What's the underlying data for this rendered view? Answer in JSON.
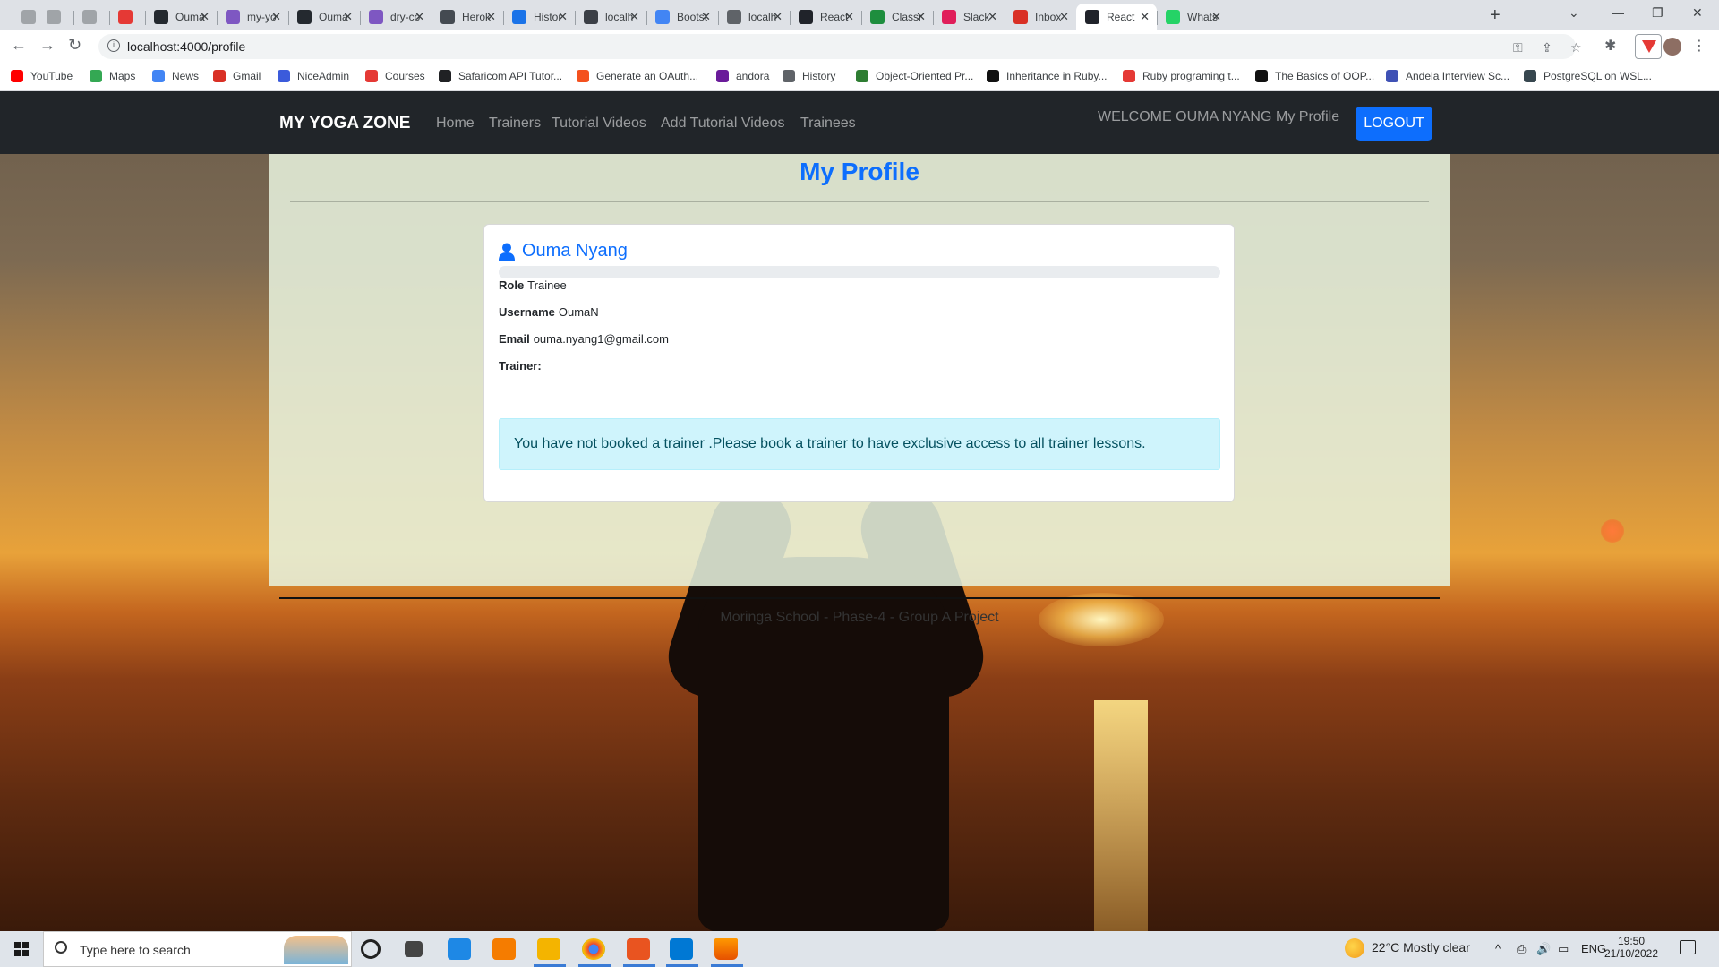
{
  "browser": {
    "tabs": [
      {
        "label": "",
        "color": "#a0a4a8"
      },
      {
        "label": "",
        "color": "#a0a4a8"
      },
      {
        "label": "",
        "color": "#a0a4a8"
      },
      {
        "label": "",
        "color": "#e53935"
      },
      {
        "label": "Ouma",
        "color": "#24292f"
      },
      {
        "label": "my-yo",
        "color": "#7e57c2"
      },
      {
        "label": "Ouma",
        "color": "#24292f"
      },
      {
        "label": "dry-co",
        "color": "#7e57c2"
      },
      {
        "label": "Herok",
        "color": "#444a51"
      },
      {
        "label": "Histor",
        "color": "#1a73e8"
      },
      {
        "label": "localh",
        "color": "#3b3f46"
      },
      {
        "label": "Bootst",
        "color": "#4285f4"
      },
      {
        "label": "localh",
        "color": "#5f6368"
      },
      {
        "label": "React",
        "color": "#20232a"
      },
      {
        "label": "Classr",
        "color": "#1e8e3e"
      },
      {
        "label": "Slack",
        "color": "#e01e5a"
      },
      {
        "label": "Inbox",
        "color": "#d93025"
      },
      {
        "label": "React",
        "color": "#20232a",
        "active": true
      },
      {
        "label": "Whats",
        "color": "#25d366"
      }
    ],
    "url": "localhost:4000/profile",
    "bookmarks": [
      {
        "label": "YouTube",
        "color": "#ff0000"
      },
      {
        "label": "Maps",
        "color": "#34a853"
      },
      {
        "label": "News",
        "color": "#4285f4"
      },
      {
        "label": "Gmail",
        "color": "#d93025"
      },
      {
        "label": "NiceAdmin",
        "color": "#3b5bdb"
      },
      {
        "label": "Courses",
        "color": "#e53935"
      },
      {
        "label": "Safaricom API Tutor...",
        "color": "#202124"
      },
      {
        "label": "Generate an OAuth...",
        "color": "#f4511e"
      },
      {
        "label": "andora",
        "color": "#6a1b9a"
      },
      {
        "label": "History",
        "color": "#5f6368"
      },
      {
        "label": "Object-Oriented Pr...",
        "color": "#2e7d32"
      },
      {
        "label": "Inheritance in Ruby...",
        "color": "#111111"
      },
      {
        "label": "Ruby programing t...",
        "color": "#e53935"
      },
      {
        "label": "The Basics of OOP...",
        "color": "#111111"
      },
      {
        "label": "Andela Interview Sc...",
        "color": "#3f51b5"
      },
      {
        "label": "PostgreSQL on WSL...",
        "color": "#37474f"
      }
    ]
  },
  "app": {
    "brand": "MY YOGA ZONE",
    "nav_links": [
      "Home",
      "Trainers",
      "Tutorial Videos",
      "Add Tutorial Videos",
      "Trainees"
    ],
    "welcome": "WELCOME OUMA NYANG",
    "my_profile": "My Profile",
    "logout": "LOGOUT"
  },
  "profile": {
    "title": "My Profile",
    "name": "Ouma Nyang",
    "role_label": "Role",
    "role": "Trainee",
    "username_label": "Username",
    "username": "OumaN",
    "email_label": "Email",
    "email": "ouma.nyang1@gmail.com",
    "trainer_label": "Trainer:",
    "alert": "You have not booked a trainer .Please book a trainer to have exclusive access to all trainer lessons."
  },
  "footer": {
    "text": "Moringa School - Phase-4 - Group A Project"
  },
  "taskbar": {
    "search_placeholder": "Type here to search",
    "weather": "22°C  Mostly clear",
    "language": "ENG",
    "time": "19:50",
    "date": "21/10/2022"
  },
  "colors": {
    "accent": "#0d6efd",
    "navbar": "#212529",
    "alert_bg": "#cff4fc"
  }
}
